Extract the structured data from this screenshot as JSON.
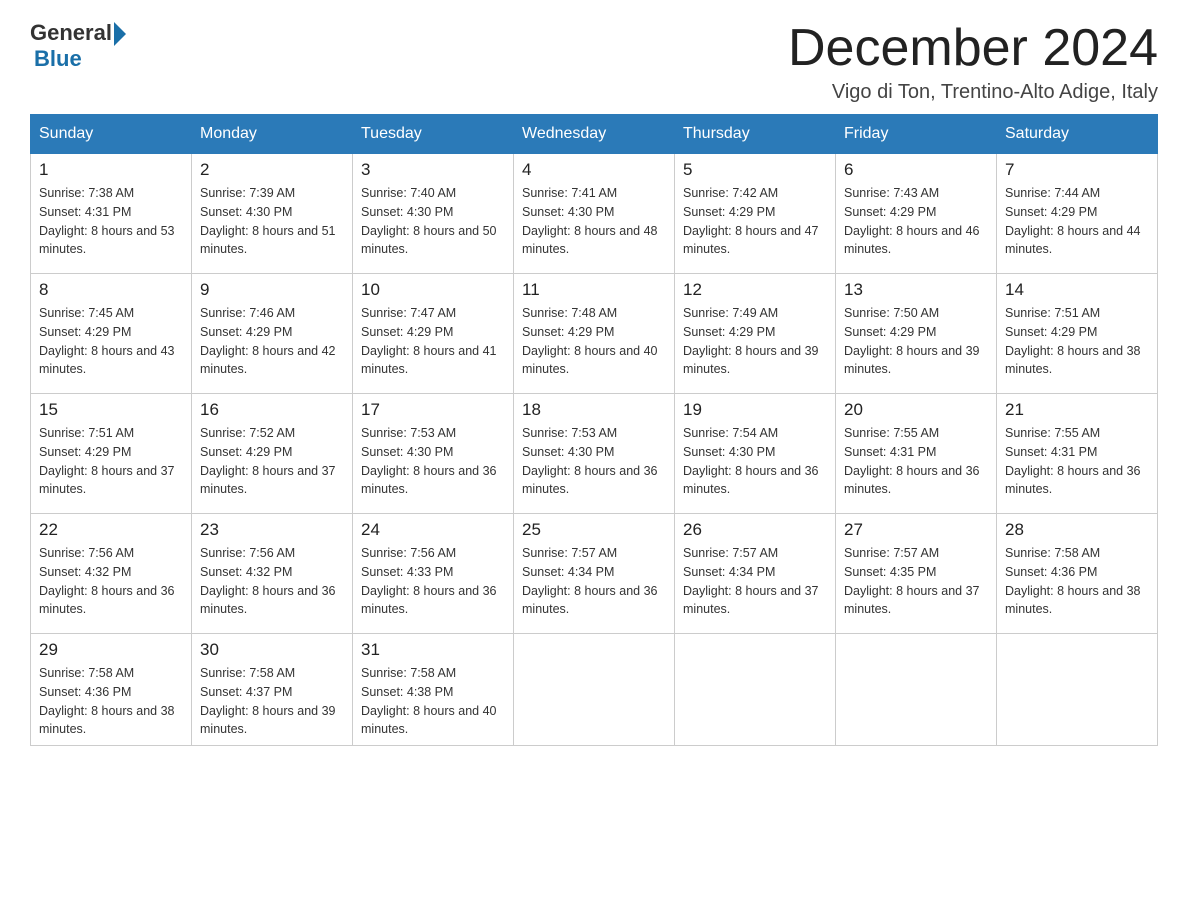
{
  "logo": {
    "general": "General",
    "blue": "Blue"
  },
  "title": "December 2024",
  "subtitle": "Vigo di Ton, Trentino-Alto Adige, Italy",
  "days_of_week": [
    "Sunday",
    "Monday",
    "Tuesday",
    "Wednesday",
    "Thursday",
    "Friday",
    "Saturday"
  ],
  "weeks": [
    [
      {
        "day": "1",
        "sunrise": "7:38 AM",
        "sunset": "4:31 PM",
        "daylight": "8 hours and 53 minutes."
      },
      {
        "day": "2",
        "sunrise": "7:39 AM",
        "sunset": "4:30 PM",
        "daylight": "8 hours and 51 minutes."
      },
      {
        "day": "3",
        "sunrise": "7:40 AM",
        "sunset": "4:30 PM",
        "daylight": "8 hours and 50 minutes."
      },
      {
        "day": "4",
        "sunrise": "7:41 AM",
        "sunset": "4:30 PM",
        "daylight": "8 hours and 48 minutes."
      },
      {
        "day": "5",
        "sunrise": "7:42 AM",
        "sunset": "4:29 PM",
        "daylight": "8 hours and 47 minutes."
      },
      {
        "day": "6",
        "sunrise": "7:43 AM",
        "sunset": "4:29 PM",
        "daylight": "8 hours and 46 minutes."
      },
      {
        "day": "7",
        "sunrise": "7:44 AM",
        "sunset": "4:29 PM",
        "daylight": "8 hours and 44 minutes."
      }
    ],
    [
      {
        "day": "8",
        "sunrise": "7:45 AM",
        "sunset": "4:29 PM",
        "daylight": "8 hours and 43 minutes."
      },
      {
        "day": "9",
        "sunrise": "7:46 AM",
        "sunset": "4:29 PM",
        "daylight": "8 hours and 42 minutes."
      },
      {
        "day": "10",
        "sunrise": "7:47 AM",
        "sunset": "4:29 PM",
        "daylight": "8 hours and 41 minutes."
      },
      {
        "day": "11",
        "sunrise": "7:48 AM",
        "sunset": "4:29 PM",
        "daylight": "8 hours and 40 minutes."
      },
      {
        "day": "12",
        "sunrise": "7:49 AM",
        "sunset": "4:29 PM",
        "daylight": "8 hours and 39 minutes."
      },
      {
        "day": "13",
        "sunrise": "7:50 AM",
        "sunset": "4:29 PM",
        "daylight": "8 hours and 39 minutes."
      },
      {
        "day": "14",
        "sunrise": "7:51 AM",
        "sunset": "4:29 PM",
        "daylight": "8 hours and 38 minutes."
      }
    ],
    [
      {
        "day": "15",
        "sunrise": "7:51 AM",
        "sunset": "4:29 PM",
        "daylight": "8 hours and 37 minutes."
      },
      {
        "day": "16",
        "sunrise": "7:52 AM",
        "sunset": "4:29 PM",
        "daylight": "8 hours and 37 minutes."
      },
      {
        "day": "17",
        "sunrise": "7:53 AM",
        "sunset": "4:30 PM",
        "daylight": "8 hours and 36 minutes."
      },
      {
        "day": "18",
        "sunrise": "7:53 AM",
        "sunset": "4:30 PM",
        "daylight": "8 hours and 36 minutes."
      },
      {
        "day": "19",
        "sunrise": "7:54 AM",
        "sunset": "4:30 PM",
        "daylight": "8 hours and 36 minutes."
      },
      {
        "day": "20",
        "sunrise": "7:55 AM",
        "sunset": "4:31 PM",
        "daylight": "8 hours and 36 minutes."
      },
      {
        "day": "21",
        "sunrise": "7:55 AM",
        "sunset": "4:31 PM",
        "daylight": "8 hours and 36 minutes."
      }
    ],
    [
      {
        "day": "22",
        "sunrise": "7:56 AM",
        "sunset": "4:32 PM",
        "daylight": "8 hours and 36 minutes."
      },
      {
        "day": "23",
        "sunrise": "7:56 AM",
        "sunset": "4:32 PM",
        "daylight": "8 hours and 36 minutes."
      },
      {
        "day": "24",
        "sunrise": "7:56 AM",
        "sunset": "4:33 PM",
        "daylight": "8 hours and 36 minutes."
      },
      {
        "day": "25",
        "sunrise": "7:57 AM",
        "sunset": "4:34 PM",
        "daylight": "8 hours and 36 minutes."
      },
      {
        "day": "26",
        "sunrise": "7:57 AM",
        "sunset": "4:34 PM",
        "daylight": "8 hours and 37 minutes."
      },
      {
        "day": "27",
        "sunrise": "7:57 AM",
        "sunset": "4:35 PM",
        "daylight": "8 hours and 37 minutes."
      },
      {
        "day": "28",
        "sunrise": "7:58 AM",
        "sunset": "4:36 PM",
        "daylight": "8 hours and 38 minutes."
      }
    ],
    [
      {
        "day": "29",
        "sunrise": "7:58 AM",
        "sunset": "4:36 PM",
        "daylight": "8 hours and 38 minutes."
      },
      {
        "day": "30",
        "sunrise": "7:58 AM",
        "sunset": "4:37 PM",
        "daylight": "8 hours and 39 minutes."
      },
      {
        "day": "31",
        "sunrise": "7:58 AM",
        "sunset": "4:38 PM",
        "daylight": "8 hours and 40 minutes."
      },
      null,
      null,
      null,
      null
    ]
  ]
}
